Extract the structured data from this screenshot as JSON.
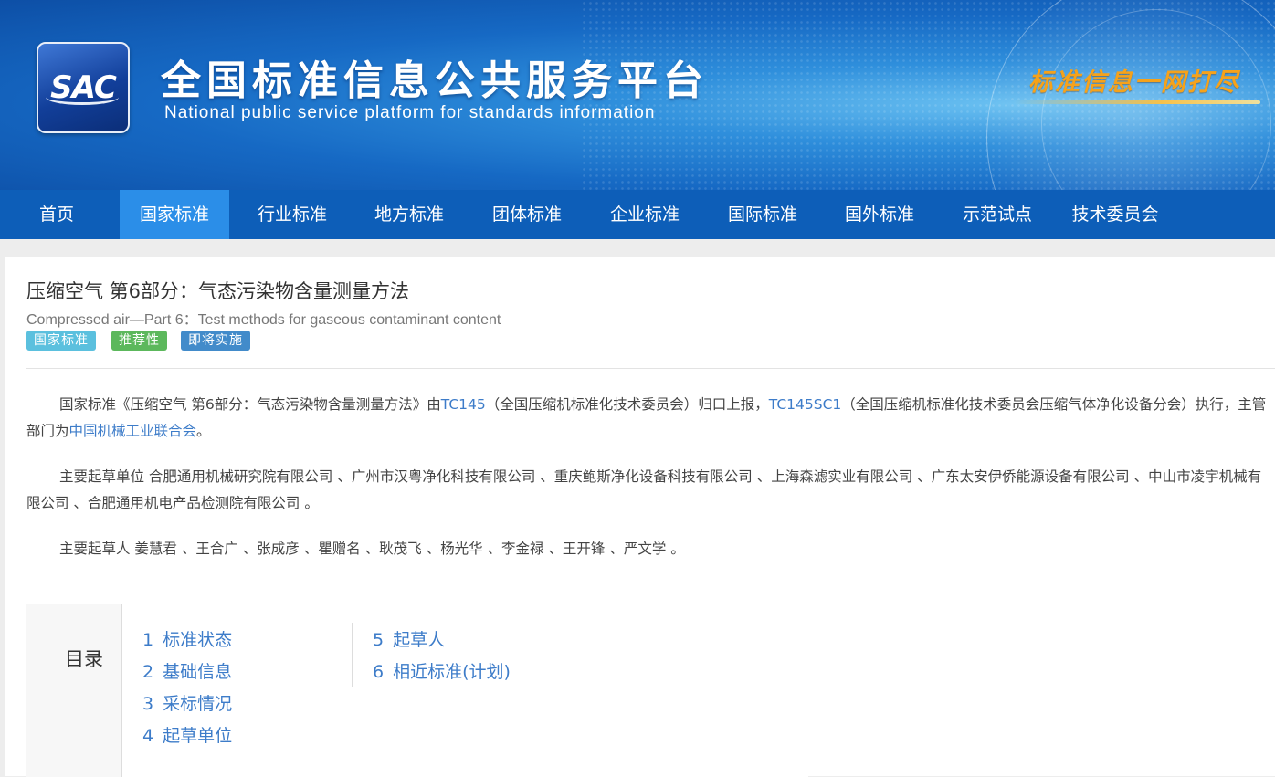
{
  "header": {
    "logo_text": "SAC",
    "title": "全国标准信息公共服务平台",
    "subtitle": "National public service platform  for standards information",
    "slogan": "标准信息一网打尽"
  },
  "nav": {
    "items": [
      "首页",
      "国家标准",
      "行业标准",
      "地方标准",
      "团体标准",
      "企业标准",
      "国际标准",
      "国外标准",
      "示范试点",
      "技术委员会"
    ],
    "active": "国家标准"
  },
  "standard": {
    "title_cn": "压缩空气 第6部分：气态污染物含量测量方法",
    "title_en": "Compressed air—Part 6：Test methods for gaseous contaminant content",
    "tags": [
      "国家标准",
      "推荐性",
      "即将实施"
    ]
  },
  "desc": {
    "p1_a": "国家标准《压缩空气 第6部分：气态污染物含量测量方法》由",
    "p1_link1": "TC145",
    "p1_b": "（全国压缩机标准化技术委员会）归口上报，",
    "p1_link2": "TC145SC1",
    "p1_c": "（全国压缩机标准化技术委员会压缩气体净化设备分会）执行，主管部门为",
    "p1_link3": "中国机械工业联合会",
    "p1_d": "。",
    "p2": "主要起草单位 合肥通用机械研究院有限公司 、广州市汉粤净化科技有限公司 、重庆鲍斯净化设备科技有限公司 、上海森滤实业有限公司 、广东太安伊侨能源设备有限公司 、中山市凌宇机械有限公司 、合肥通用机电产品检测院有限公司 。",
    "p3": "主要起草人 姜慧君 、王合广 、张成彦 、瞿赠名 、耿茂飞 、杨光华 、李金禄 、王开锋 、严文学 。"
  },
  "toc": {
    "label": "目录",
    "items": [
      {
        "num": "1",
        "label": "标准状态"
      },
      {
        "num": "2",
        "label": "基础信息"
      },
      {
        "num": "3",
        "label": "采标情况"
      },
      {
        "num": "4",
        "label": "起草单位"
      },
      {
        "num": "5",
        "label": "起草人"
      },
      {
        "num": "6",
        "label": "相近标准(计划)"
      }
    ]
  },
  "colors": {
    "nav_bg": "#0d5eb8",
    "nav_active": "#2b8ee8",
    "link": "#3d7cc9",
    "tag_national": "#5bc0de",
    "tag_recommended": "#5cb85c",
    "tag_upcoming": "#428bca"
  }
}
